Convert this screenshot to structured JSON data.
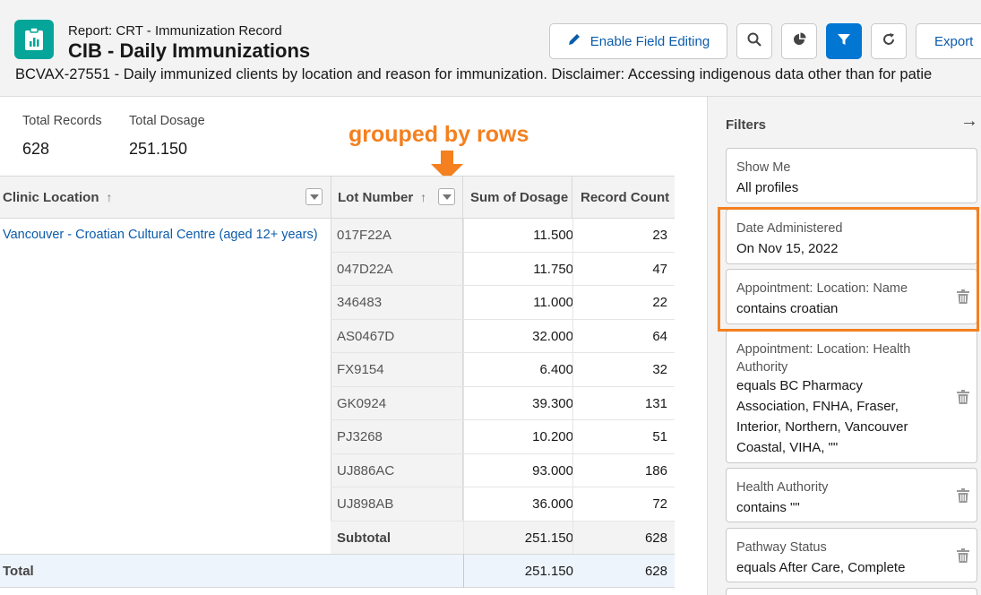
{
  "header": {
    "report_type": "Report: CRT - Immunization Record",
    "title": "CIB - Daily Immunizations",
    "description": "BCVAX-27551 - Daily immunized clients by location and reason for immunization. Disclaimer: Accessing indigenous data other than for patie",
    "buttons": {
      "edit_label": "Enable Field Editing",
      "export_label": "Export"
    },
    "icons": [
      "report-icon",
      "pencil-icon",
      "search-icon",
      "chart-icon",
      "filter-icon",
      "refresh-icon"
    ]
  },
  "summary": {
    "total_records_label": "Total Records",
    "total_records_value": "628",
    "total_dosage_label": "Total Dosage",
    "total_dosage_value": "251.150"
  },
  "annotation": {
    "text": "grouped by rows",
    "color": "#f4801f"
  },
  "table": {
    "columns": [
      "Clinic Location",
      "Lot Number",
      "Sum of Dosage",
      "Record Count"
    ],
    "group_label": "Vancouver - Croatian Cultural Centre (aged 12+ years)",
    "rows": [
      {
        "lot": "017F22A",
        "dosage": "11.500",
        "count": "23"
      },
      {
        "lot": "047D22A",
        "dosage": "11.750",
        "count": "47"
      },
      {
        "lot": "346483",
        "dosage": "11.000",
        "count": "22"
      },
      {
        "lot": "AS0467D",
        "dosage": "32.000",
        "count": "64"
      },
      {
        "lot": "FX9154",
        "dosage": "6.400",
        "count": "32"
      },
      {
        "lot": "GK0924",
        "dosage": "39.300",
        "count": "131"
      },
      {
        "lot": "PJ3268",
        "dosage": "10.200",
        "count": "51"
      },
      {
        "lot": "UJ886AC",
        "dosage": "93.000",
        "count": "186"
      },
      {
        "lot": "UJ898AB",
        "dosage": "36.000",
        "count": "72"
      }
    ],
    "subtotal": {
      "label": "Subtotal",
      "dosage": "251.150",
      "count": "628"
    },
    "total": {
      "label": "Total",
      "dosage": "251.150",
      "count": "628"
    }
  },
  "filters": {
    "title": "Filters",
    "items": [
      {
        "label": "Show Me",
        "value": "All profiles"
      },
      {
        "label": "Date Administered",
        "value": "On Nov 15, 2022"
      },
      {
        "label": "Appointment: Location: Name",
        "value": "contains croatian"
      },
      {
        "label_lines": [
          "Appointment: Location: Health",
          "Authority"
        ],
        "value_lines": [
          "equals BC Pharmacy",
          "Association, FNHA, Fraser,",
          "Interior, Northern, Vancouver",
          "Coastal, VIHA, \"\""
        ]
      },
      {
        "label": "Health Authority",
        "value": "contains \"\""
      },
      {
        "label": "Pathway Status",
        "value": "equals After Care, Complete"
      }
    ]
  },
  "colors": {
    "accent": "#0176d3",
    "link": "#0b5cab",
    "report_icon": "#06a59a",
    "annotation": "#f4801f"
  }
}
